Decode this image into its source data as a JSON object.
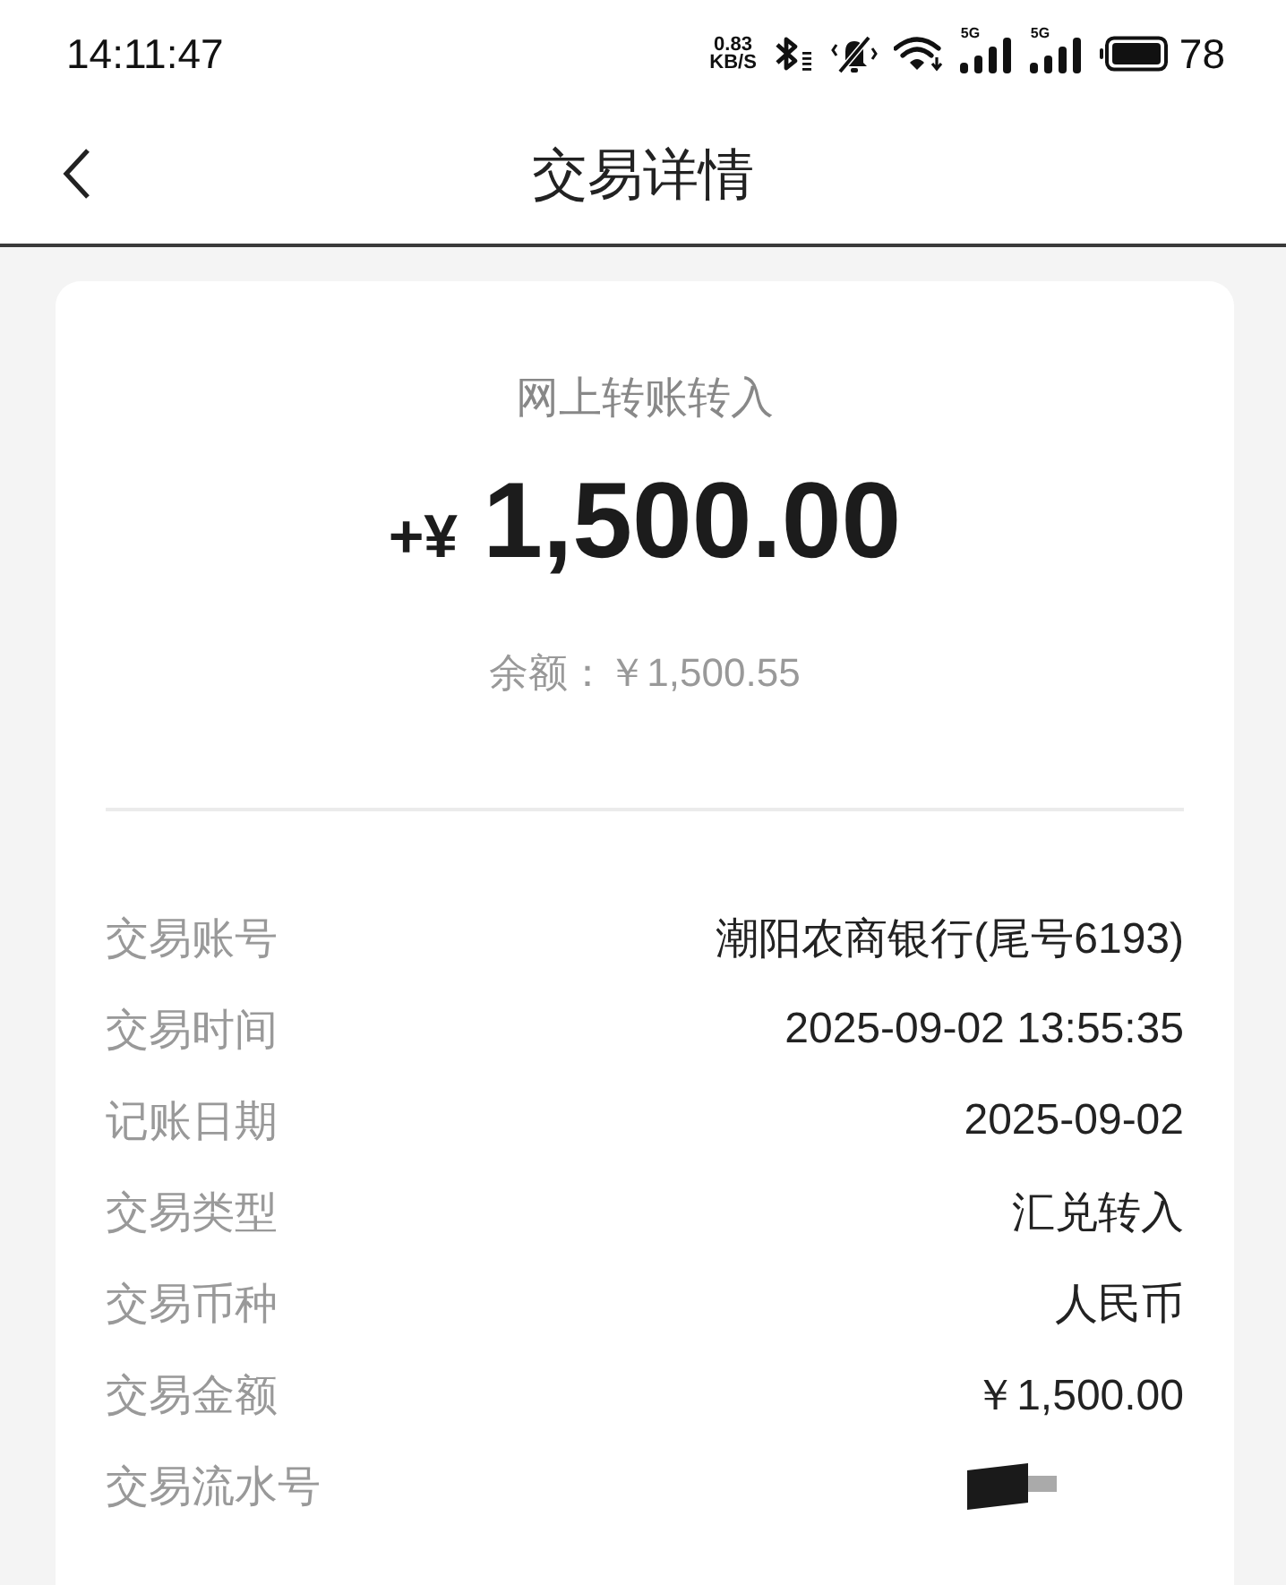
{
  "status_bar": {
    "time": "14:11:47",
    "net_speed": "0.83",
    "net_speed_unit": "KB/S",
    "signals": [
      {
        "label": "5G"
      },
      {
        "label": "5G"
      }
    ],
    "battery_text": "78"
  },
  "header": {
    "title": "交易详情"
  },
  "summary": {
    "type_label": "网上转账转入",
    "amount_prefix": "+¥",
    "amount": "1,500.00",
    "balance": "余额：￥1,500.55"
  },
  "details": [
    {
      "kind": "text",
      "label": "交易账号",
      "value": "潮阳农商银行(尾号6193)"
    },
    {
      "kind": "text",
      "label": "交易时间",
      "value": "2025-09-02 13:55:35"
    },
    {
      "kind": "text",
      "label": "记账日期",
      "value": "2025-09-02"
    },
    {
      "kind": "text",
      "label": "交易类型",
      "value": "汇兑转入"
    },
    {
      "kind": "text",
      "label": "交易币种",
      "value": "人民币"
    },
    {
      "kind": "text",
      "label": "交易金额",
      "value": "￥1,500.00"
    },
    {
      "kind": "redacted",
      "label": "交易流水号"
    }
  ]
}
